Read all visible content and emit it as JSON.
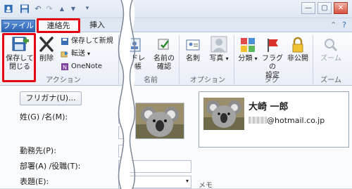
{
  "quickaccess": {
    "undo": "↶",
    "redo": "↷",
    "up": "▲",
    "down": "▼"
  },
  "window": {
    "min": "—",
    "max": "▢",
    "close": "✕"
  },
  "tabs": {
    "file": "ファイル",
    "contact": "連絡先",
    "insert": "挿入"
  },
  "ribbon_right": {
    "help": "?",
    "collapse": "⌃"
  },
  "ribbon": {
    "save_close": [
      "保存して",
      "閉じる"
    ],
    "delete": "削除",
    "save_new": "保存して新規",
    "forward": "転送",
    "onenote": "OneNote",
    "group_action": "アクション",
    "address_book": "アドレス帳",
    "check_names": [
      "名前の",
      "確認"
    ],
    "group_names": "名前",
    "business_card": "名刺",
    "picture": "写真",
    "group_options": "オプション",
    "categorize": "分類",
    "follow_up": [
      "フラグの",
      "設定"
    ],
    "private": "非公開",
    "group_tags": "タグ",
    "zoom": "ズーム",
    "group_zoom": "ズーム"
  },
  "form": {
    "furigana_button": "フリガナ(U)...",
    "name_label": "姓(G) /名(M):",
    "company_label": "勤務先(P):",
    "dept_label": "部署(A) /役職(T):",
    "fileas_label": "表題(E):",
    "notes_label": "メモ"
  },
  "card": {
    "name": "大崎 一郎",
    "email": "@hotmail.co.jp"
  }
}
